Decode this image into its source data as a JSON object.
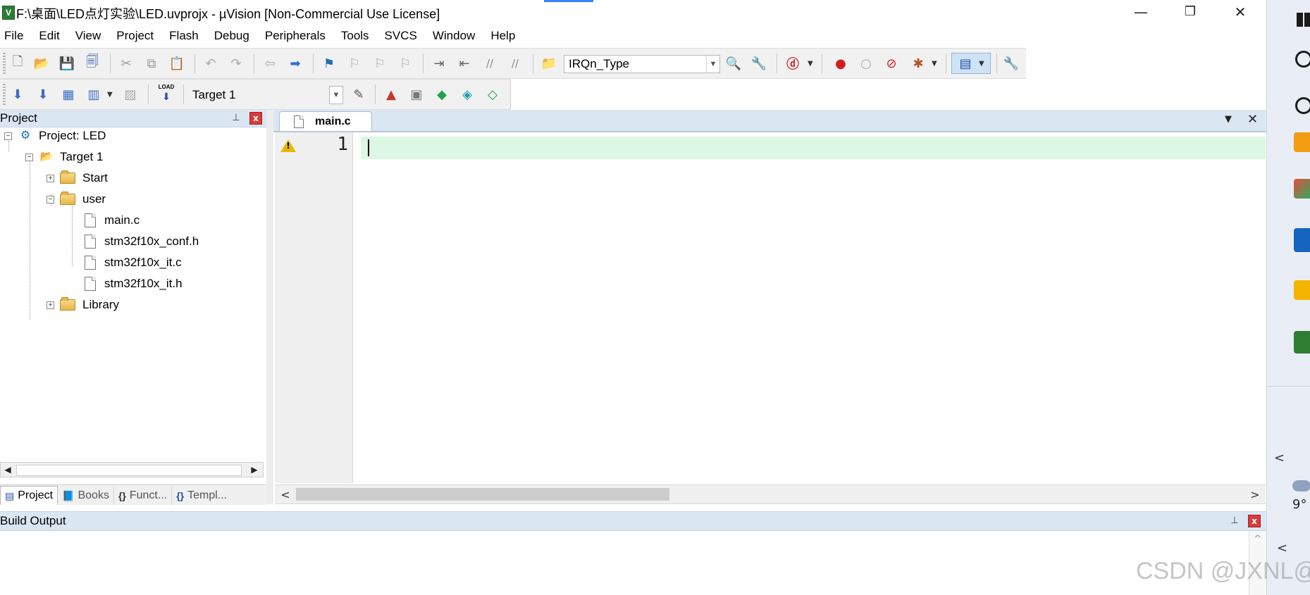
{
  "window": {
    "title": "F:\\桌面\\LED点灯实验\\LED.uvprojx - µVision  [Non-Commercial Use License]",
    "app_icon_text": "V",
    "minimize": "—",
    "restore": "❐",
    "close": "✕"
  },
  "menu": [
    "File",
    "Edit",
    "View",
    "Project",
    "Flash",
    "Debug",
    "Peripherals",
    "Tools",
    "SVCS",
    "Window",
    "Help"
  ],
  "toolbar1": {
    "find_combo_value": "IRQn_Type",
    "icons": {
      "new": "🗋",
      "open": "📂",
      "save": "💾",
      "save_all": "🗐",
      "cut": "✂",
      "copy": "⧉",
      "paste": "📋",
      "undo": "↶",
      "redo": "↷",
      "nav_back": "⇦",
      "nav_fwd": "➡",
      "bookmark": "⚑",
      "bm_prev": "⚐",
      "bm_next": "⚐",
      "bm_clear": "⚐",
      "indent": "⇥",
      "unindent": "⇤",
      "comment": "//",
      "uncomment": "//",
      "find_in_files": "📁",
      "find": "🔍",
      "replace": "🔧",
      "debug_session": "ⓓ",
      "breakpoint": "●",
      "bp_disable": "○",
      "bp_kill": "⊘",
      "bp_tools": "✱",
      "window_layout": "▤",
      "config": "🔧"
    }
  },
  "toolbar2": {
    "target_combo_value": "Target 1",
    "load_label": "LOAD",
    "icons": {
      "translate": "⬇",
      "build": "⬇",
      "rebuild": "▦",
      "batch": "▥",
      "stop": "▨",
      "options": "✎",
      "manage": "▲",
      "components": "▣",
      "pack": "◆",
      "select_pack": "◈",
      "packs_installer": "◇"
    }
  },
  "project_panel": {
    "header": "Project",
    "pin": "⊥",
    "close": "x",
    "tree": [
      {
        "label": "Project: LED",
        "kind": "project",
        "expander": "−"
      },
      {
        "label": "Target 1",
        "kind": "target",
        "expander": "−"
      },
      {
        "label": "Start",
        "kind": "folder",
        "expander": "+"
      },
      {
        "label": "user",
        "kind": "folder",
        "expander": "−"
      },
      {
        "label": "main.c",
        "kind": "file"
      },
      {
        "label": "stm32f10x_conf.h",
        "kind": "file"
      },
      {
        "label": "stm32f10x_it.c",
        "kind": "file"
      },
      {
        "label": "stm32f10x_it.h",
        "kind": "file"
      },
      {
        "label": "Library",
        "kind": "folder",
        "expander": "+"
      }
    ],
    "scroll_left": "◀",
    "scroll_right": "▶",
    "tabs": [
      {
        "label": "Project",
        "icon": "▤"
      },
      {
        "label": "Books",
        "icon": "📘"
      },
      {
        "label": "Funct...",
        "icon": "{}"
      },
      {
        "label": "Templ...",
        "icon": "{}"
      }
    ]
  },
  "editor": {
    "tab_label": "main.c",
    "tab_menu": "▼",
    "tab_close": "✕",
    "line_number": "1",
    "warning_mark": "!",
    "scroll_left": "<",
    "scroll_right": ">"
  },
  "build_output": {
    "header": "Build Output",
    "pin": "⊥",
    "close": "x",
    "scroll_up": "^"
  },
  "side_strip": {
    "chevron_left": "<",
    "weather_temp": "9°",
    "chevron_left2": "<"
  },
  "watermark": "CSDN @JXNL@"
}
